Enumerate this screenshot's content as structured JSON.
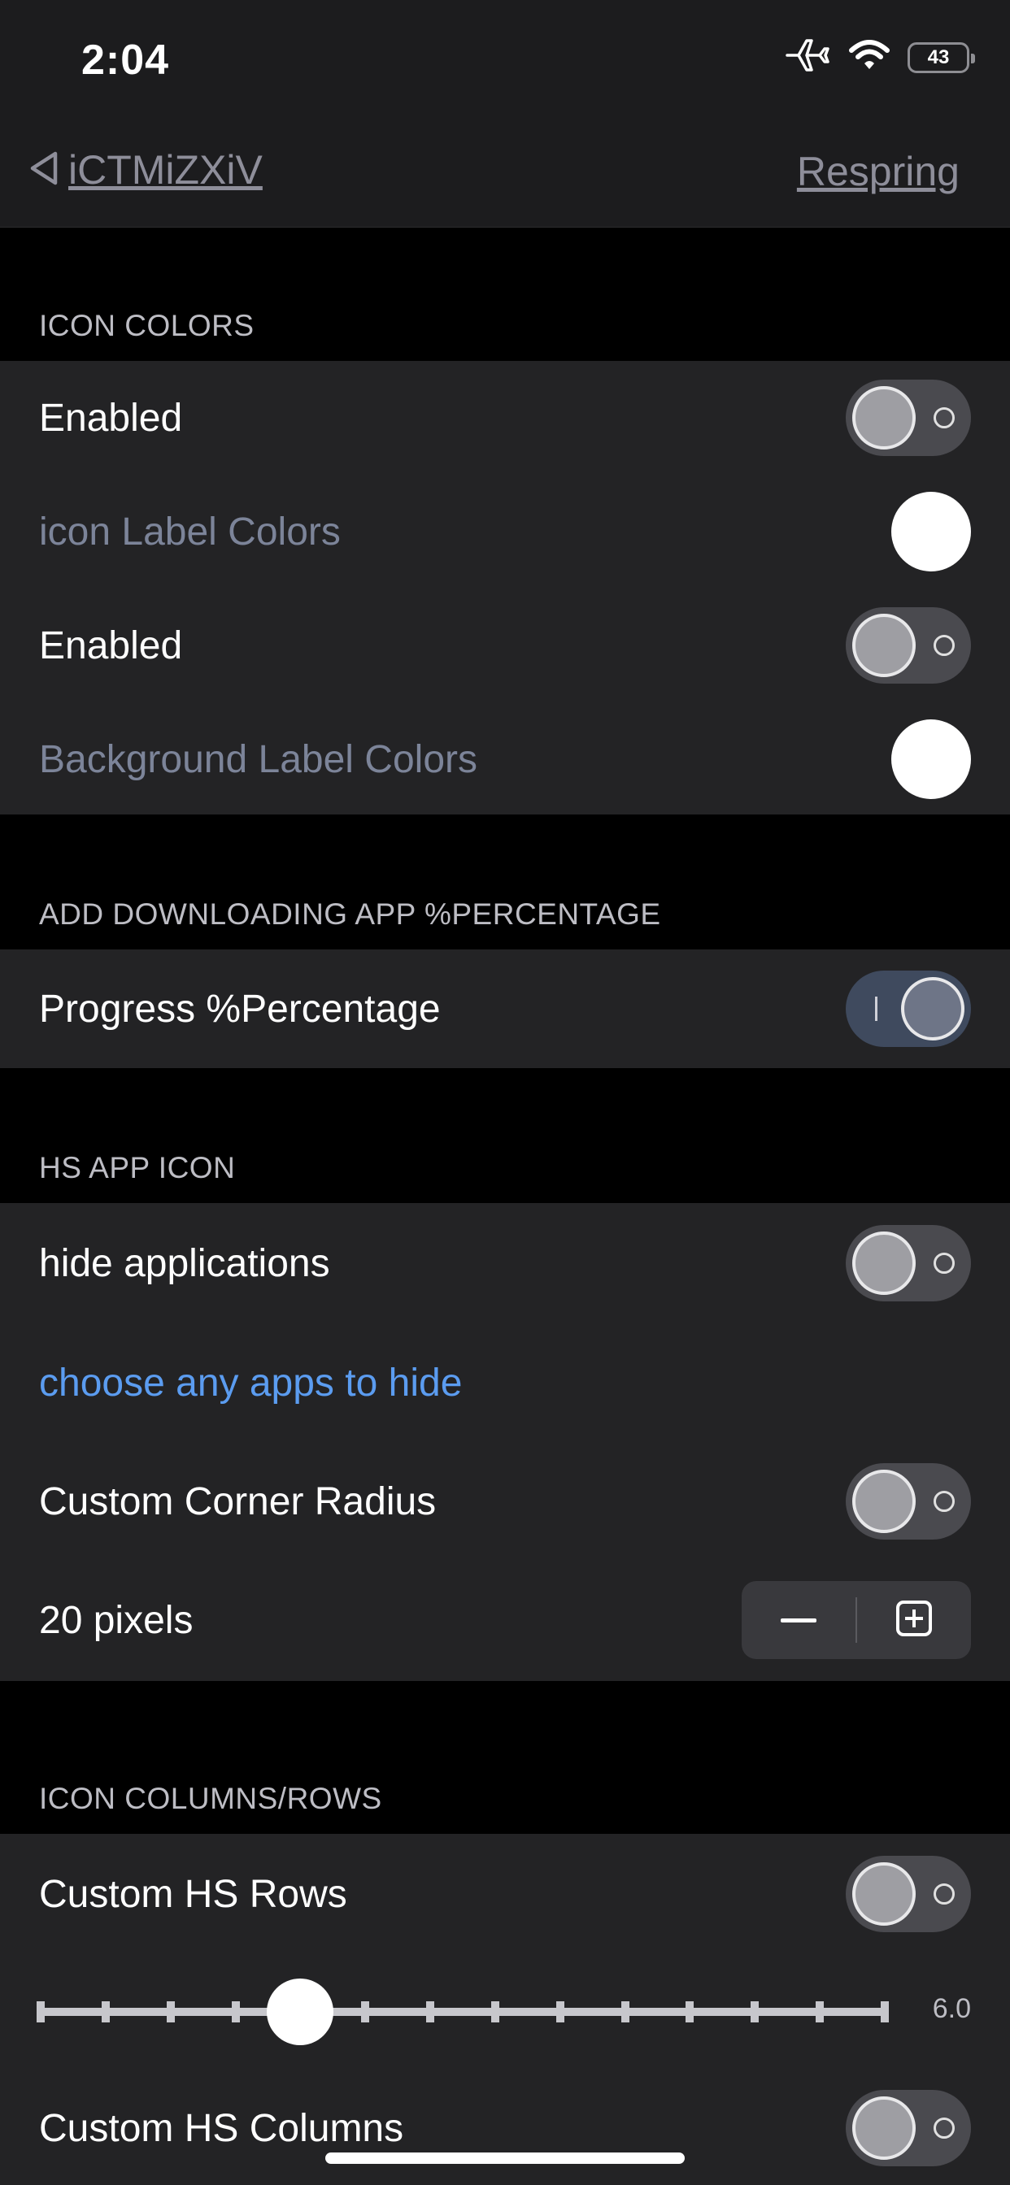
{
  "status_bar": {
    "time": "2:04",
    "battery_level": "43",
    "icons": [
      "airplane-icon",
      "wifi-icon",
      "battery-icon"
    ]
  },
  "navbar": {
    "back_label": "iCTMiZXiV",
    "respring_label": "Respring"
  },
  "sections": {
    "icon_colors": {
      "header": "ICON COLORS",
      "rows": [
        {
          "label": "Enabled",
          "toggle": false
        },
        {
          "label": "icon Label Colors",
          "color": "#ffffff"
        },
        {
          "label": "Enabled",
          "toggle": false
        },
        {
          "label": "Background Label Colors",
          "color": "#ffffff"
        }
      ]
    },
    "downloading": {
      "header": "ADD DOWNLOADING APP %PERCENTAGE",
      "rows": [
        {
          "label": "Progress %Percentage",
          "toggle": true
        }
      ]
    },
    "hs_app_icon": {
      "header": "HS APP ICON",
      "rows": [
        {
          "label": "hide applications",
          "toggle": false
        },
        {
          "label": "choose any apps to hide"
        },
        {
          "label": "Custom Corner Radius",
          "toggle": false
        },
        {
          "label": "20 pixels"
        }
      ]
    },
    "columns_rows": {
      "header": "ICON COLUMNS/ROWS",
      "rows": [
        {
          "label": "Custom HS Rows",
          "toggle": false
        },
        {
          "slider_value": "6.0",
          "slider_min": 1,
          "slider_max": 14,
          "slider_current": 5
        },
        {
          "label": "Custom HS Columns",
          "toggle": false
        }
      ]
    }
  },
  "colors": {
    "background": "#000000",
    "group_background": "#232325",
    "link": "#5b9cf0",
    "muted_label": "#7c8499"
  }
}
